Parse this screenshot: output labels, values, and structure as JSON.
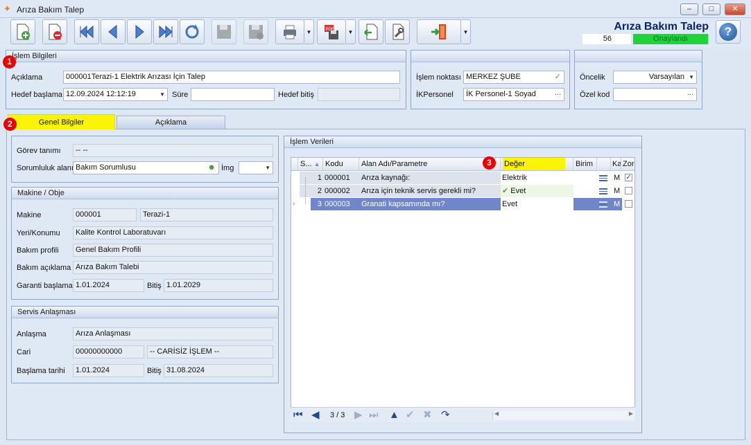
{
  "window": {
    "title": "Arıza Bakım Talep"
  },
  "header": {
    "title": "Arıza Bakım Talep",
    "number": "56",
    "status": "Onaylandı",
    "status_color": "#1fd43b"
  },
  "colors": {
    "highlight_yellow": "#fbf406",
    "badge_red": "#e00000",
    "selected_row": "#6f86c9"
  },
  "toolbar": {
    "icons": [
      "new-doc-icon",
      "delete-doc-icon",
      "first-record-icon",
      "prev-record-icon",
      "next-record-icon",
      "last-record-icon",
      "refresh-icon",
      "save-icon",
      "save-close-icon",
      "print-icon",
      "pdf-export-icon",
      "attach-icon",
      "settings-wrench-icon",
      "exit-door-icon",
      "overflow-icon"
    ]
  },
  "islem_bilgileri": {
    "title": "İşlem Bilgileri",
    "aciklama_label": "Açıklama",
    "aciklama_value": "000001Terazi-1 Elektrik Arızası İçin Talep",
    "hedef_baslama_label": "Hedef başlama",
    "hedef_baslama_value": "12.09.2024 12:12:19",
    "sure_label": "Süre",
    "sure_value": "",
    "hedef_bitis_label": "Hedef bitiş",
    "hedef_bitis_value": ""
  },
  "islem_noktasi": {
    "islem_noktasi_label": "İşlem noktası",
    "islem_noktasi_value": "MERKEZ ŞUBE",
    "ikpersonel_label": "İKPersonel",
    "ikpersonel_value": "İK Personel-1 Soyad"
  },
  "oncelik": {
    "oncelik_label": "Öncelik",
    "oncelik_value": "Varsayılan",
    "ozel_kod_label": "Özel kod",
    "ozel_kod_value": ""
  },
  "badges": {
    "b1": "1",
    "b2": "2",
    "b3": "3"
  },
  "tabs": {
    "genel": "Genel Bilgiler",
    "aciklama": "Açıklama"
  },
  "gorev": {
    "gorev_tanimi_label": "Görev tanımı",
    "gorev_tanimi_value": "-- --",
    "sorumluluk_label": "Sorumluluk alanı",
    "sorumluluk_value": "Bakım Sorumlusu",
    "img_label": "İmg",
    "img_value": ""
  },
  "makine": {
    "title": "Makine / Obje",
    "makine_label": "Makine",
    "makine_code": "000001",
    "makine_name": "Terazi-1",
    "yeri_label": "Yeri/Konumu",
    "yeri_value": "Kalite Kontrol Laboratuvarı",
    "profil_label": "Bakım profili",
    "profil_value": "Genel Bakım Profili",
    "aciklama_label": "Bakım açıklama",
    "aciklama_value": "Arıza Bakım Talebi",
    "garanti_label": "Garanti başlama",
    "garanti_value": "1.01.2024",
    "bitis_label": "Bitiş",
    "bitis_value": "1.01.2029"
  },
  "servis": {
    "title": "Servis Anlaşması",
    "anlasma_label": "Anlaşma",
    "anlasma_value": "Arıza Anlaşması",
    "cari_label": "Cari",
    "cari_code": "00000000000",
    "cari_name": "-- CARİSİZ İŞLEM --",
    "baslama_label": "Başlama tarihi",
    "baslama_value": "1.01.2024",
    "bitis_label": "Bitiş",
    "bitis_value": "31.08.2024"
  },
  "islem_verileri": {
    "title": "İşlem Verileri",
    "columns": {
      "sira": "S...",
      "kodu": "Kodu",
      "alan": "Alan Adı/Parametre",
      "deger": "Değer",
      "birim": "Birim",
      "ka": "Ka",
      "zor": "Zor"
    },
    "rows": [
      {
        "sira": "1",
        "kodu": "000001",
        "alan": "Arıza kaynağı:",
        "deger": "Elektrik",
        "m": "M",
        "zorunlu": "✓"
      },
      {
        "sira": "2",
        "kodu": "000002",
        "alan": "Arıza için teknik servis gerekli mi?",
        "deger": "Evet",
        "m": "M",
        "zorunlu": ""
      },
      {
        "sira": "3",
        "kodu": "000003",
        "alan": "Granati kapsamında mı?",
        "deger": "Evet",
        "m": "M",
        "zorunlu": ""
      }
    ],
    "pager": "3 / 3"
  }
}
